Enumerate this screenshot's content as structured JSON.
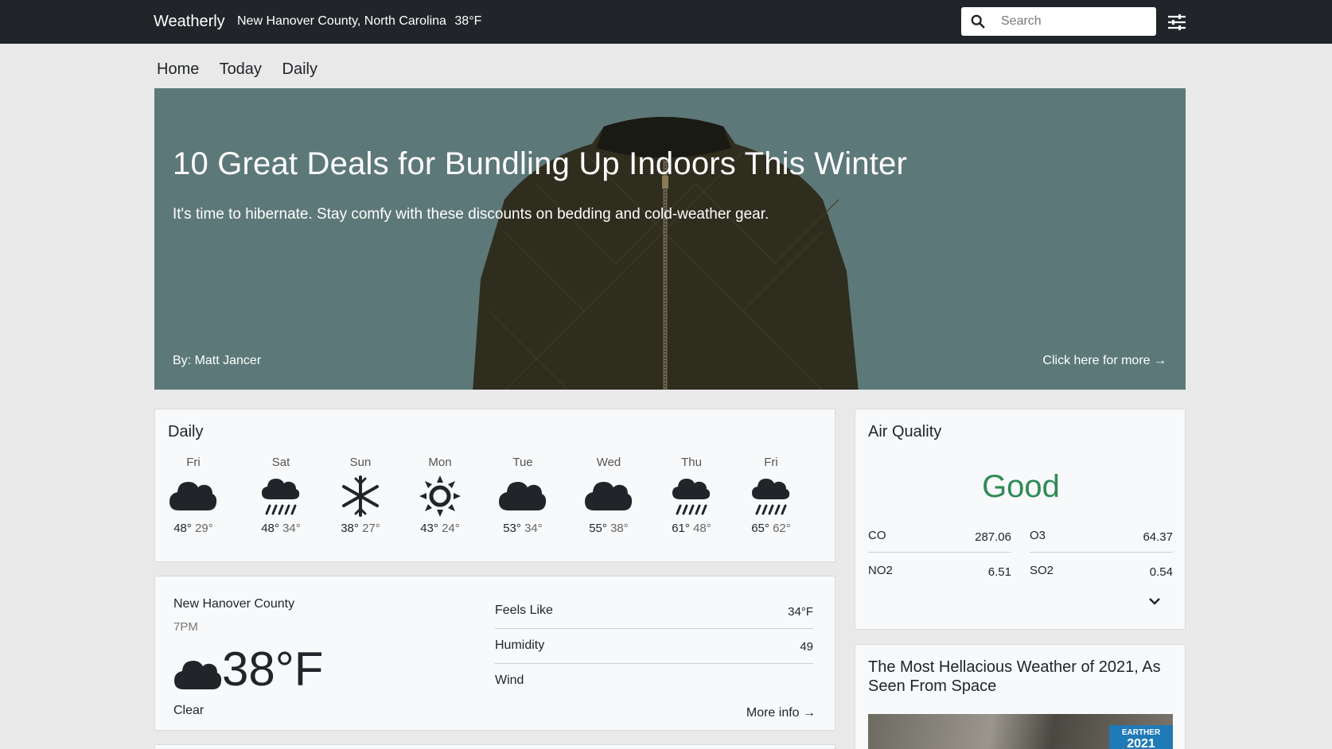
{
  "header": {
    "brand": "Weatherly",
    "location": "New Hanover County, North Carolina",
    "temp": "38°F",
    "search_placeholder": "Search"
  },
  "nav": [
    "Home",
    "Today",
    "Daily"
  ],
  "hero": {
    "title": "10 Great Deals for Bundling Up Indoors This Winter",
    "subtitle": "It's time to hibernate. Stay comfy with these discounts on bedding and cold-weather gear.",
    "author": "By: Matt Jancer",
    "more": "Click here for more →"
  },
  "daily": {
    "title": "Daily",
    "days": [
      {
        "name": "Fri",
        "icon": "cloud-icon",
        "hi": "48°",
        "lo": "29°"
      },
      {
        "name": "Sat",
        "icon": "rain-icon",
        "hi": "48°",
        "lo": "34°"
      },
      {
        "name": "Sun",
        "icon": "snowflake-icon",
        "hi": "38°",
        "lo": "27°"
      },
      {
        "name": "Mon",
        "icon": "sun-icon",
        "hi": "43°",
        "lo": "24°"
      },
      {
        "name": "Tue",
        "icon": "cloud-icon",
        "hi": "53°",
        "lo": "34°"
      },
      {
        "name": "Wed",
        "icon": "cloud-icon",
        "hi": "55°",
        "lo": "38°"
      },
      {
        "name": "Thu",
        "icon": "rain-icon",
        "hi": "61°",
        "lo": "48°"
      },
      {
        "name": "Fri",
        "icon": "rain-icon",
        "hi": "65°",
        "lo": "62°"
      }
    ]
  },
  "current": {
    "location": "New Hanover County",
    "time": "7PM",
    "temp": "38°F",
    "condition": "Clear",
    "icon": "cloud-icon",
    "metrics": [
      {
        "label": "Feels Like",
        "value": "34°F"
      },
      {
        "label": "Humidity",
        "value": "49"
      },
      {
        "label": "Wind",
        "value": ""
      }
    ],
    "more": "More info →"
  },
  "air_quality": {
    "title": "Air Quality",
    "status": "Good",
    "pollutants": [
      {
        "name": "CO",
        "value": "287.06"
      },
      {
        "name": "O3",
        "value": "64.37"
      },
      {
        "name": "NO2",
        "value": "6.51"
      },
      {
        "name": "SO2",
        "value": "0.54"
      }
    ]
  },
  "news": {
    "title": "The Most Hellacious Weather of 2021, As Seen From Space",
    "badge_line1": "EARTHER",
    "badge_line2": "2021"
  },
  "colors": {
    "topbar": "#212529",
    "hero_bg": "#5d7878",
    "aq_good": "#2e8b57"
  }
}
